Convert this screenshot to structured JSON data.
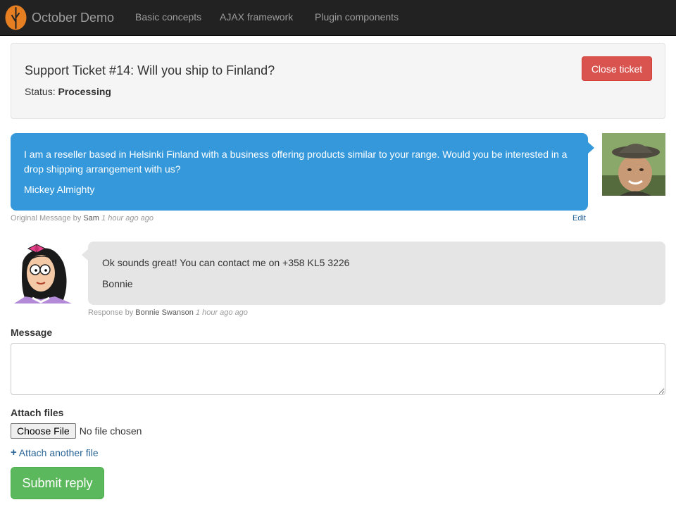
{
  "navbar": {
    "brand": "October Demo",
    "links": [
      "Basic concepts",
      "AJAX framework",
      "Plugin components"
    ]
  },
  "ticket": {
    "title": "Support Ticket #14: Will you ship to Finland?",
    "status_label": "Status:",
    "status_value": "Processing",
    "close_button": "Close ticket"
  },
  "messages": [
    {
      "text": "I am a reseller based in Helsinki Finland with a business offering products similar to your range. Would you be interested in a drop shipping arrangement with us?",
      "signature": "Mickey Almighty",
      "meta_prefix": "Original Message by",
      "author": "Sam",
      "time": "1 hour ago ago",
      "edit_label": "Edit"
    },
    {
      "text": "Ok sounds great! You can contact me on +358 KL5 3226",
      "signature": "Bonnie",
      "meta_prefix": "Response by",
      "author": "Bonnie Swanson",
      "time": "1 hour ago ago"
    }
  ],
  "form": {
    "message_label": "Message",
    "message_value": "",
    "attach_label": "Attach files",
    "choose_file_button": "Choose File",
    "file_status": "No file chosen",
    "attach_another": "Attach another file",
    "submit_button": "Submit reply"
  },
  "colors": {
    "navbar_bg": "#222222",
    "brand_logo": "#e67e22",
    "close_button": "#d9534f",
    "bubble_blue": "#3498db",
    "bubble_grey": "#e5e5e5",
    "submit_button": "#5cb85c",
    "link": "#2a6496"
  },
  "icons": {
    "brand": "october-leaf-icon",
    "attach": "plus-icon"
  }
}
